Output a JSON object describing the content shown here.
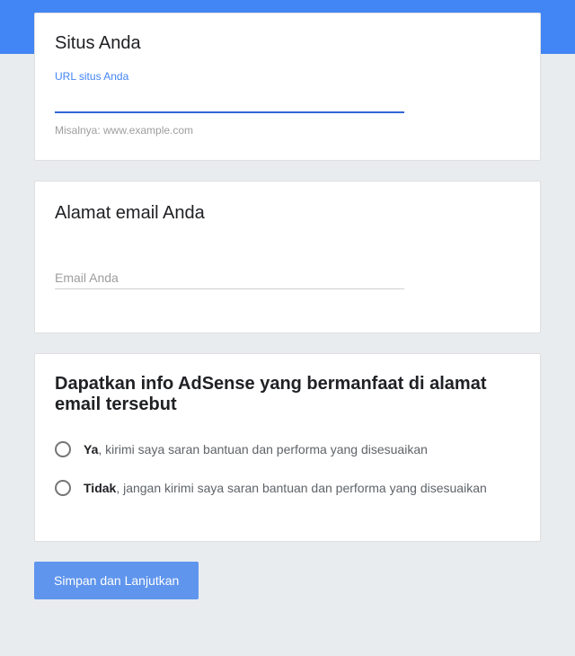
{
  "card1": {
    "title": "Situs Anda",
    "fieldLabel": "URL situs Anda",
    "inputValue": "",
    "helper": "Misalnya: www.example.com"
  },
  "card2": {
    "title": "Alamat email Anda",
    "placeholder": "Email Anda",
    "inputValue": ""
  },
  "card3": {
    "title": "Dapatkan info AdSense yang bermanfaat di alamat email tersebut",
    "options": [
      {
        "bold": "Ya",
        "rest": ", kirimi saya saran bantuan dan performa yang disesuaikan"
      },
      {
        "bold": "Tidak",
        "rest": ", jangan kirimi saya saran bantuan dan performa yang disesuaikan"
      }
    ]
  },
  "submit": {
    "label": "Simpan dan Lanjutkan"
  }
}
